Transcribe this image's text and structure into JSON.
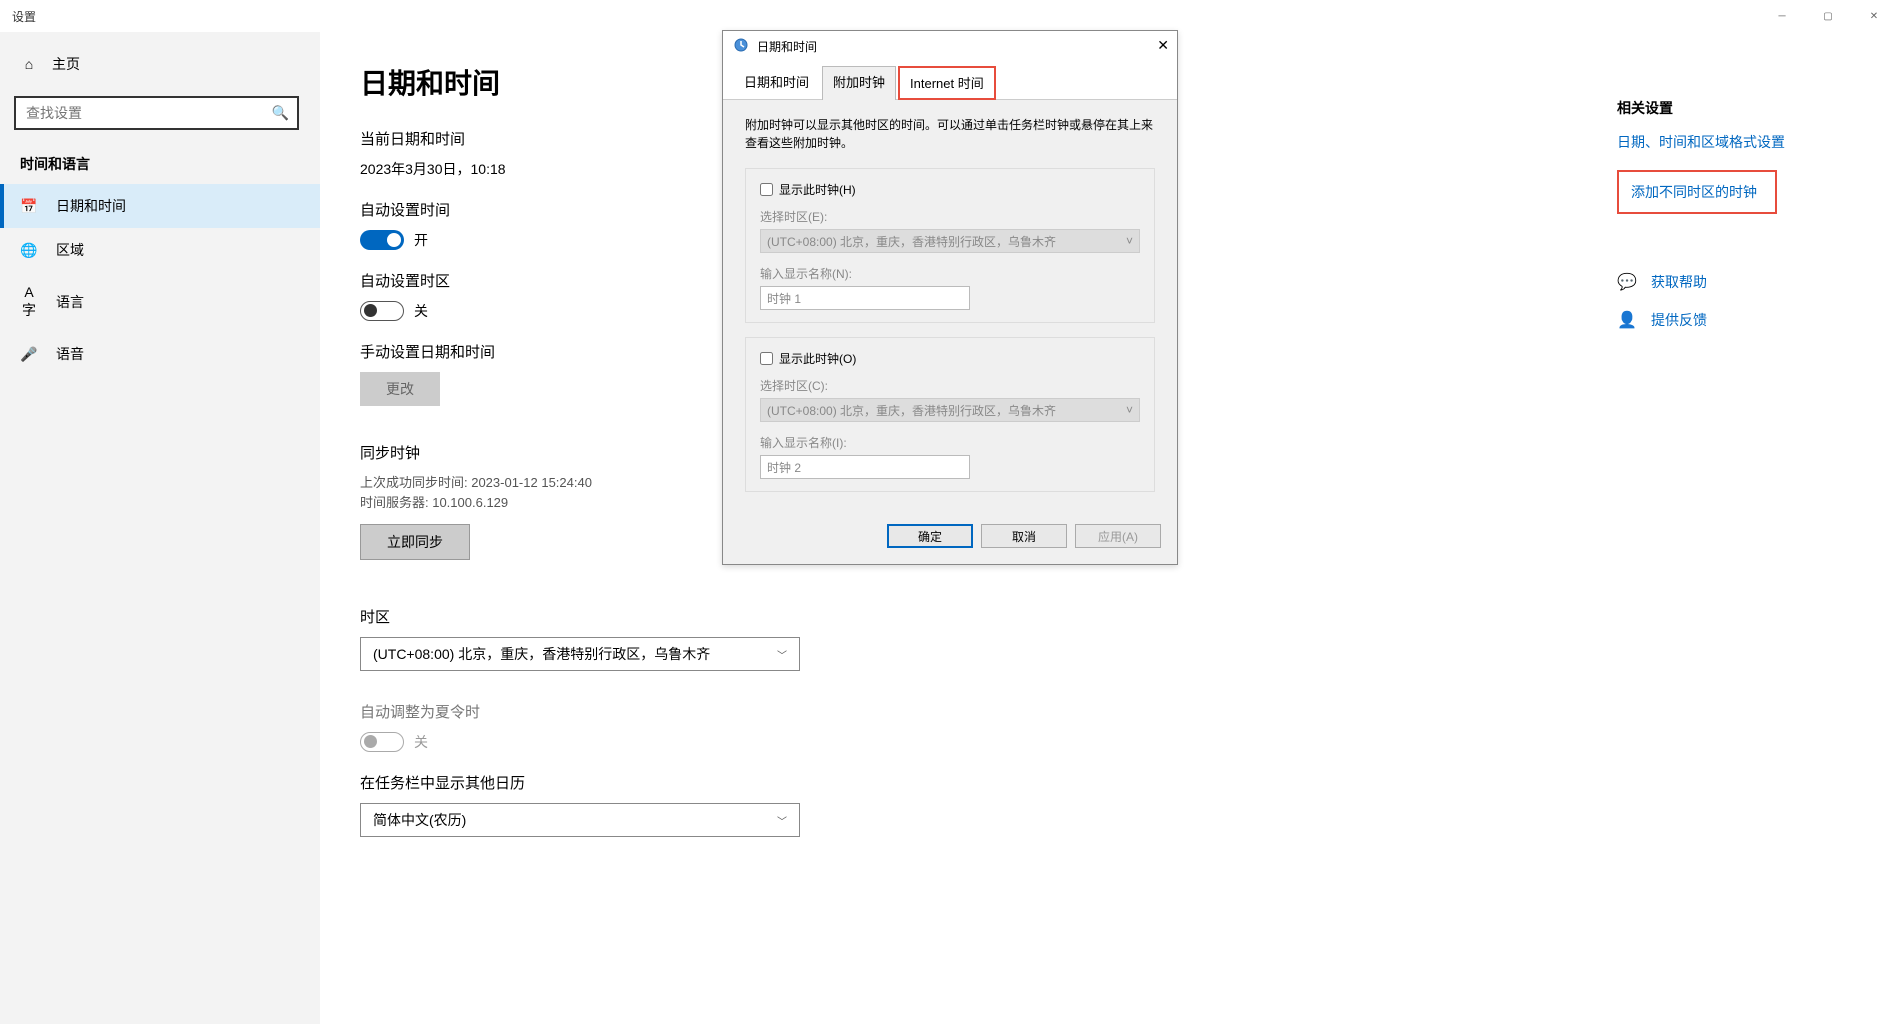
{
  "titlebar": "设置",
  "sidebar": {
    "home": "主页",
    "search_placeholder": "查找设置",
    "section": "时间和语言",
    "items": [
      {
        "label": "日期和时间"
      },
      {
        "label": "区域"
      },
      {
        "label": "语言"
      },
      {
        "label": "语音"
      }
    ]
  },
  "main": {
    "title": "日期和时间",
    "current_label": "当前日期和时间",
    "current_value": "2023年3月30日，10:18",
    "auto_time_label": "自动设置时间",
    "auto_time_state": "开",
    "auto_tz_label": "自动设置时区",
    "auto_tz_state": "关",
    "manual_label": "手动设置日期和时间",
    "manual_btn": "更改",
    "sync_h": "同步时钟",
    "sync_last": "上次成功同步时间: 2023-01-12 15:24:40",
    "sync_server": "时间服务器: 10.100.6.129",
    "sync_btn": "立即同步",
    "tz_h": "时区",
    "tz_value": "(UTC+08:00) 北京，重庆，香港特别行政区，乌鲁木齐",
    "dst_label": "自动调整为夏令时",
    "dst_state": "关",
    "other_cal_label": "在任务栏中显示其他日历",
    "other_cal_value": "简体中文(农历)"
  },
  "right": {
    "related_h": "相关设置",
    "link1": "日期、时间和区域格式设置",
    "link2": "添加不同时区的时钟",
    "help": "获取帮助",
    "feedback": "提供反馈"
  },
  "dialog": {
    "title": "日期和时间",
    "tabs": [
      "日期和时间",
      "附加时钟",
      "Internet 时间"
    ],
    "desc": "附加时钟可以显示其他时区的时间。可以通过单击任务栏时钟或悬停在其上来查看这些附加时钟。",
    "show_clock1": "显示此时钟(H)",
    "select_tz1": "选择时区(E):",
    "tz1_value": "(UTC+08:00) 北京，重庆，香港特别行政区，乌鲁木齐",
    "name1_label": "输入显示名称(N):",
    "name1_value": "时钟 1",
    "show_clock2": "显示此时钟(O)",
    "select_tz2": "选择时区(C):",
    "tz2_value": "(UTC+08:00) 北京，重庆，香港特别行政区，乌鲁木齐",
    "name2_label": "输入显示名称(I):",
    "name2_value": "时钟 2",
    "ok": "确定",
    "cancel": "取消",
    "apply": "应用(A)"
  }
}
